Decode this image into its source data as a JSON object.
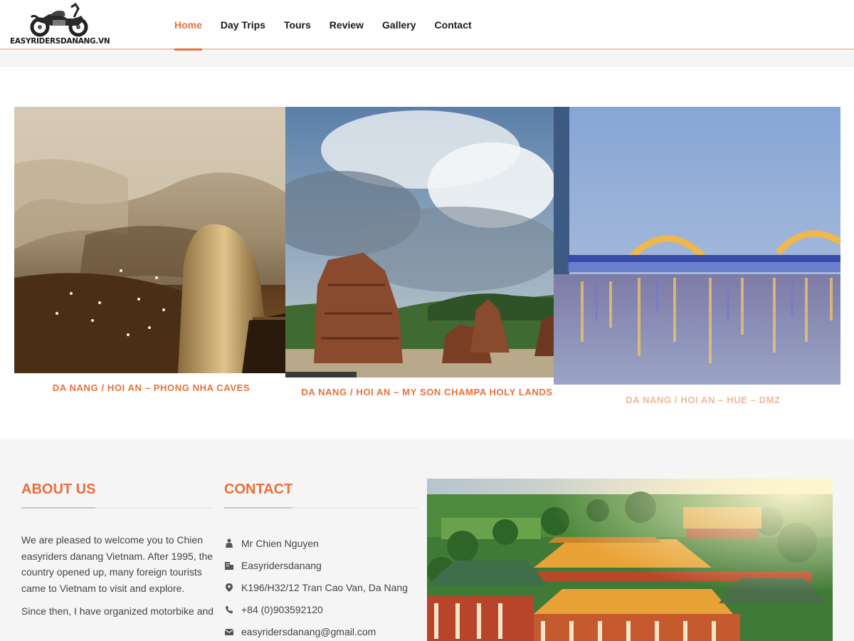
{
  "header": {
    "logo_text": "EASYRIDERSDANANG.VN",
    "nav": [
      {
        "label": "Home",
        "active": true
      },
      {
        "label": "Day Trips"
      },
      {
        "label": "Tours"
      },
      {
        "label": "Review"
      },
      {
        "label": "Gallery"
      },
      {
        "label": "Contact"
      }
    ]
  },
  "tours": [
    {
      "label": "DA NANG / HOI AN – PHONG NHA CAVES"
    },
    {
      "label": "DA NANG / HOI AN – MY SON CHAMPA HOLY LANDS"
    },
    {
      "label": "DA NANG / HOI AN – HUE – DMZ"
    }
  ],
  "footer": {
    "about": {
      "title": "ABOUT US",
      "paragraphs": [
        "We are pleased to welcome you to Chien easyriders danang Vietnam. After 1995, the country opened up, many foreign tourists came to Vietnam to visit and explore.",
        "Since then, I have organized motorbike and"
      ]
    },
    "contact": {
      "title": "CONTACT",
      "items": [
        {
          "icon": "person-icon",
          "text": "Mr Chien Nguyen"
        },
        {
          "icon": "building-icon",
          "text": "Easyridersdanang"
        },
        {
          "icon": "map-pin-icon",
          "text": "K196/H32/12 Tran Cao Van, Da Nang"
        },
        {
          "icon": "phone-icon",
          "text": "+84 (0)903592120"
        },
        {
          "icon": "email-icon",
          "text": "easyridersdanang@gmail.com"
        }
      ]
    }
  },
  "colors": {
    "accent": "#e8703a",
    "footer_bg": "#f5f5f5"
  }
}
